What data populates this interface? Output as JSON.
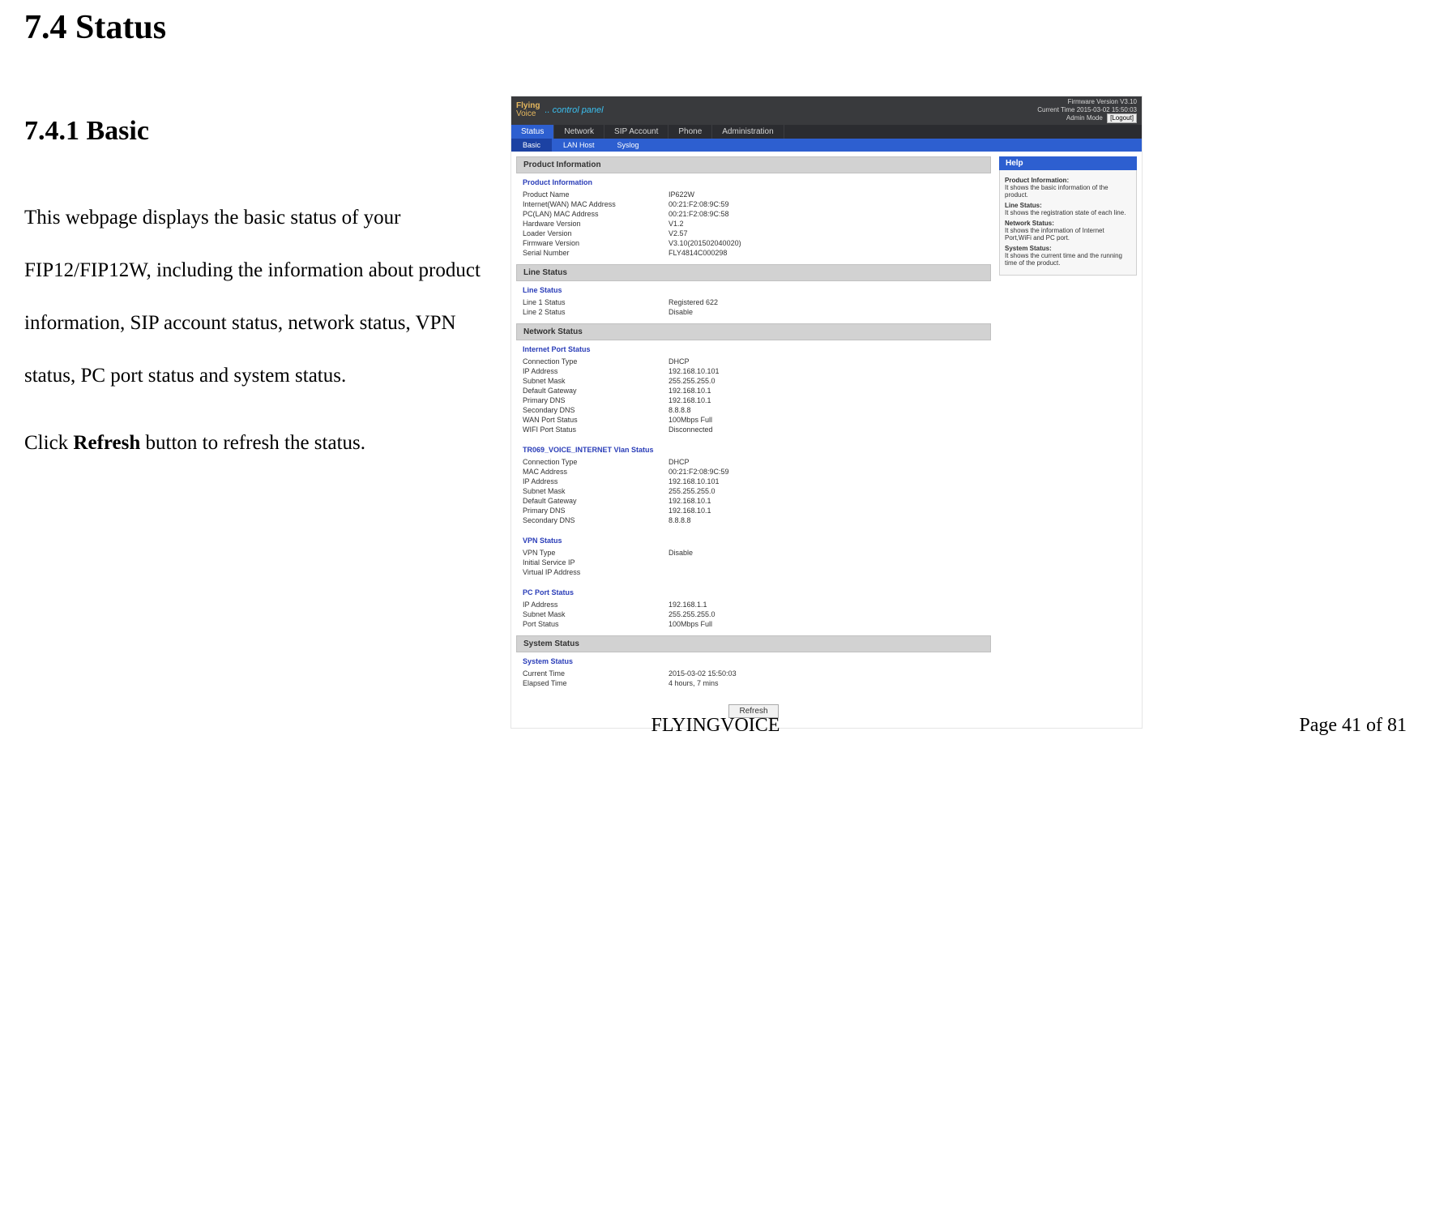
{
  "doc": {
    "section_heading": "7.4   Status",
    "subsection_heading": "7.4.1     Basic",
    "para1": "This webpage displays the basic status of your FIP12/FIP12W, including the information about product information, SIP account status, network status, VPN status, PC port status and system status.",
    "para2_prefix": "Click ",
    "para2_bold": "Refresh",
    "para2_suffix": " button to refresh the status.",
    "footer_center": "FLYINGVOICE",
    "footer_right": "Page  41  of  81"
  },
  "ui": {
    "brand_line1": "Flying",
    "brand_line2": "Voice",
    "control_panel_label": ".. control panel",
    "firmware_line": "Firmware Version V3.10",
    "current_time_line": "Current Time 2015-03-02 15:50:03",
    "admin_mode_label": "Admin Mode",
    "logout_label": "[Logout]",
    "nav_tabs": [
      "Status",
      "Network",
      "SIP Account",
      "Phone",
      "Administration"
    ],
    "subnav_tabs": [
      "Basic",
      "LAN Host",
      "Syslog"
    ],
    "sections": {
      "product_info_title": "Product Information",
      "product_info_header": "Product Information",
      "product_info": [
        {
          "k": "Product Name",
          "v": "IP622W"
        },
        {
          "k": "Internet(WAN) MAC Address",
          "v": "00:21:F2:08:9C:59"
        },
        {
          "k": "PC(LAN) MAC Address",
          "v": "00:21:F2:08:9C:58"
        },
        {
          "k": "Hardware Version",
          "v": "V1.2"
        },
        {
          "k": "Loader Version",
          "v": "V2.57"
        },
        {
          "k": "Firmware Version",
          "v": "V3.10(201502040020)"
        },
        {
          "k": "Serial Number",
          "v": "FLY4814C000298"
        }
      ],
      "line_status_title": "Line Status",
      "line_status_header": "Line Status",
      "line_status": [
        {
          "k": "Line 1 Status",
          "v": "Registered 622"
        },
        {
          "k": "Line 2 Status",
          "v": "Disable"
        }
      ],
      "network_status_title": "Network Status",
      "internet_port_header": "Internet Port Status",
      "internet_port": [
        {
          "k": "Connection Type",
          "v": "DHCP"
        },
        {
          "k": "IP Address",
          "v": "192.168.10.101"
        },
        {
          "k": "Subnet Mask",
          "v": "255.255.255.0"
        },
        {
          "k": "Default Gateway",
          "v": "192.168.10.1"
        },
        {
          "k": "Primary DNS",
          "v": "192.168.10.1"
        },
        {
          "k": "Secondary DNS",
          "v": "8.8.8.8"
        },
        {
          "k": "WAN Port Status",
          "v": "100Mbps Full"
        },
        {
          "k": "WIFI Port Status",
          "v": "Disconnected"
        }
      ],
      "tr069_header": "TR069_VOICE_INTERNET Vlan Status",
      "tr069": [
        {
          "k": "Connection Type",
          "v": "DHCP"
        },
        {
          "k": "MAC Address",
          "v": "00:21:F2:08:9C:59"
        },
        {
          "k": "IP Address",
          "v": "192.168.10.101"
        },
        {
          "k": "Subnet Mask",
          "v": "255.255.255.0"
        },
        {
          "k": "Default Gateway",
          "v": "192.168.10.1"
        },
        {
          "k": "Primary DNS",
          "v": "192.168.10.1"
        },
        {
          "k": "Secondary DNS",
          "v": "8.8.8.8"
        }
      ],
      "vpn_header": "VPN Status",
      "vpn": [
        {
          "k": "VPN Type",
          "v": "Disable"
        },
        {
          "k": "Initial Service IP",
          "v": ""
        },
        {
          "k": "Virtual IP Address",
          "v": ""
        }
      ],
      "pcport_header": "PC Port Status",
      "pcport": [
        {
          "k": "IP Address",
          "v": "192.168.1.1"
        },
        {
          "k": "Subnet Mask",
          "v": "255.255.255.0"
        },
        {
          "k": "Port Status",
          "v": "100Mbps Full"
        }
      ],
      "system_status_title": "System Status",
      "system_status_header": "System Status",
      "system_status": [
        {
          "k": "Current Time",
          "v": "2015-03-02 15:50:03"
        },
        {
          "k": "Elapsed Time",
          "v": "4 hours, 7 mins"
        }
      ],
      "refresh_label": "Refresh"
    },
    "help": {
      "title": "Help",
      "items": [
        {
          "h": "Product Information:",
          "b": "It shows the basic information of the product."
        },
        {
          "h": "Line Status:",
          "b": "It shows the registration state of each line."
        },
        {
          "h": "Network Status:",
          "b": "It shows the information of Internet Port,WiFi and PC port."
        },
        {
          "h": "System Status:",
          "b": "It shows the current time and the running time of the product."
        }
      ]
    }
  }
}
